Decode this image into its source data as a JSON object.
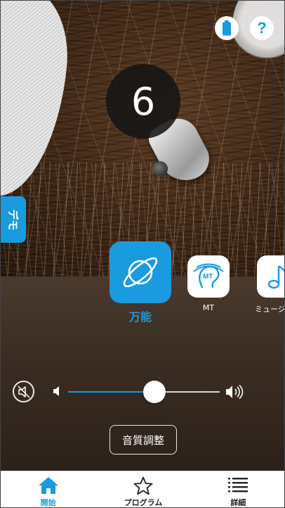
{
  "hero": {
    "program_number": "6"
  },
  "header": {
    "battery_icon": "battery-icon",
    "help_label": "?"
  },
  "demo_tab": {
    "label": "デモ"
  },
  "programs": [
    {
      "label": "万能",
      "icon": "planet-icon",
      "selected": true
    },
    {
      "label": "MT",
      "icon": "mt-ear-icon",
      "selected": false
    },
    {
      "label": "ミュージック",
      "icon": "music-note-icon",
      "selected": false
    }
  ],
  "volume": {
    "level": 0.57,
    "mute_icon": "mute-speaker-icon",
    "low_icon": "volume-low-icon",
    "high_icon": "volume-high-icon"
  },
  "sound_adjust": {
    "label": "音質調整"
  },
  "tabbar": {
    "items": [
      {
        "label": "開始",
        "icon": "home-icon",
        "active": true
      },
      {
        "label": "プログラム",
        "icon": "star-icon",
        "active": false
      },
      {
        "label": "詳細",
        "icon": "list-icon",
        "active": false
      }
    ]
  },
  "colors": {
    "accent": "#1a9be0",
    "tabbar_bg": "#ffffff",
    "control_bg": "#3a2c22"
  }
}
